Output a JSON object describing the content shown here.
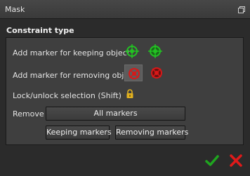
{
  "window": {
    "title": "Mask",
    "restore_icon": "restore-window-icon"
  },
  "constraint": {
    "section_title": "Constraint type",
    "keep_label": "Add marker for keeping object",
    "remove_label": "Add marker for removing object",
    "lock_label": "Lock/unlock selection (Shift)",
    "remove_row_label": "Remove",
    "all_markers": "All markers",
    "keeping_markers": "Keeping markers",
    "removing_markers": "Removing markers"
  },
  "icons": {
    "keep_add": "green-target-plus-icon",
    "keep_brush": "green-target-icon",
    "remove_add": "red-target-icon",
    "remove_brush": "red-target-minus-icon",
    "lock": "lock-icon",
    "ok": "green-checkmark-icon",
    "cancel": "red-x-icon"
  },
  "colors": {
    "keep_green": "#22c222",
    "remove_red": "#d81818",
    "lock_gold": "#e0b020",
    "ok_green": "#1fa61f",
    "cancel_red": "#e01a1a"
  }
}
